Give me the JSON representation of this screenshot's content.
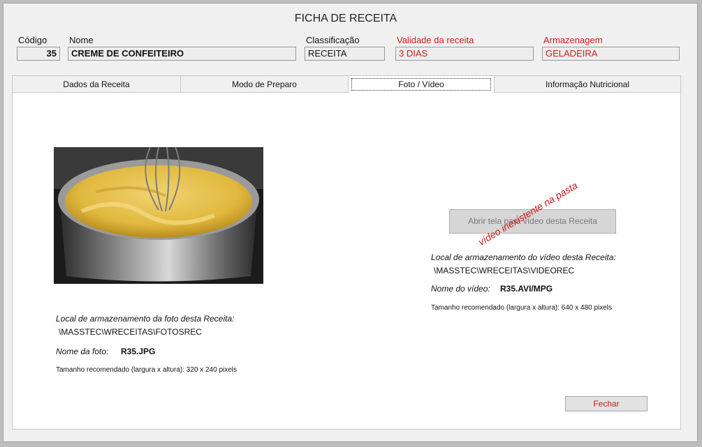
{
  "window": {
    "title": "FICHA DE RECEITA"
  },
  "header": {
    "codigo": {
      "label": "Código",
      "value": "35"
    },
    "nome": {
      "label": "Nome",
      "value": "CREME DE CONFEITEIRO"
    },
    "classificacao": {
      "label": "Classificação",
      "value": "RECEITA"
    },
    "validade": {
      "label": "Validade da receita",
      "value": "3 DIAS"
    },
    "armazenagem": {
      "label": "Armazenagem",
      "value": "GELADEIRA"
    }
  },
  "tabs": [
    {
      "label": "Dados da Receita"
    },
    {
      "label": "Modo de Preparo"
    },
    {
      "label": "Foto / Vídeo"
    },
    {
      "label": "Informação Nutricional"
    }
  ],
  "photo": {
    "storage_label": "Local de armazenamento da foto desta Receita:",
    "storage_path": "\\MASSTEC\\WRECEITAS\\FOTOSREC",
    "name_label": "Nome da foto:",
    "name_value": "R35.JPG",
    "size_hint": "Tamanho recomendado (largura x altura): 320 x 240 pixels"
  },
  "video": {
    "open_button": "Abrir tela para vídeo desta Receita",
    "missing_notice": "vídeo inexistente na pasta",
    "storage_label": "Local de armazenamento do vídeo desta Receita:",
    "storage_path": "\\MASSTEC\\WRECEITAS\\VIDEOREC",
    "name_label": "Nome do vídeo:",
    "name_value": "R35.AVI/MPG",
    "size_hint": "Tamanho recomendado (largura x altura): 640 x 480 pixels"
  },
  "footer": {
    "close_button": "Fechar"
  },
  "colors": {
    "warning_red": "#d11a1a",
    "panel_bg": "#ffffff",
    "window_bg": "#f0f0f0"
  }
}
